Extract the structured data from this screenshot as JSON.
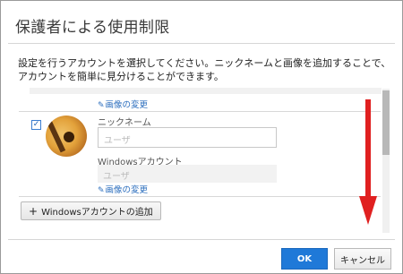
{
  "dialog": {
    "title": "保護者による使用制限",
    "description": "設定を行うアカウントを選択してください。ニックネームと画像を追加することで、アカウントを簡単に見分けることができます。"
  },
  "accounts": {
    "previous_change_image": "画像の変更",
    "current": {
      "checked": true,
      "nickname_label": "ニックネーム",
      "nickname_value": "ユーザ",
      "windows_account_label": "Windowsアカウント",
      "windows_account_value": "ユーザ",
      "change_image": "画像の変更"
    },
    "add_button": "Windowsアカウントの追加"
  },
  "footer": {
    "ok": "OK",
    "cancel": "キャンセル"
  },
  "colors": {
    "accent": "#1f79d8",
    "link": "#2d6fbe",
    "annotation_arrow": "#e02020"
  },
  "icons": {
    "pencil": "✎",
    "plus": "+",
    "check": "✓"
  }
}
